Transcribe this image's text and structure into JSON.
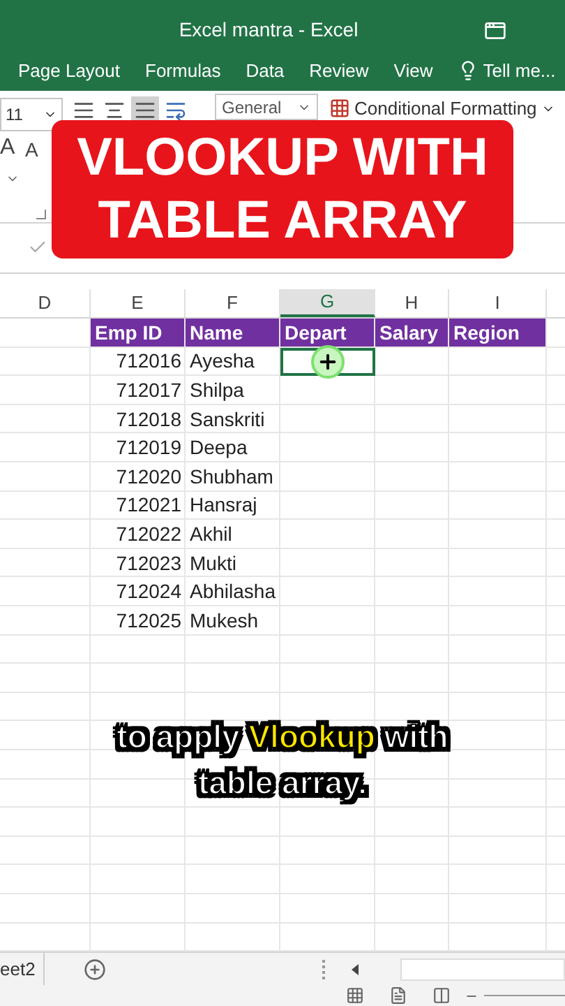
{
  "window": {
    "title": "Excel mantra - Excel"
  },
  "ribbon_tabs": [
    "Page Layout",
    "Formulas",
    "Data",
    "Review",
    "View"
  ],
  "tell_me": "Tell me...",
  "ribbon": {
    "font_size": "11",
    "font_grow": "A",
    "font_shrink": "A",
    "number_format": "General",
    "conditional_formatting": "Conditional Formatting"
  },
  "banner": {
    "lines": [
      "VLOOKUP WITH",
      "TABLE ARRAY"
    ]
  },
  "columns": [
    {
      "label": "D",
      "selected": false
    },
    {
      "label": "E",
      "selected": false
    },
    {
      "label": "F",
      "selected": false
    },
    {
      "label": "G",
      "selected": true
    },
    {
      "label": "H",
      "selected": false
    },
    {
      "label": "I",
      "selected": false
    }
  ],
  "table": {
    "columns": [
      "Emp ID",
      "Name",
      "Depart",
      "Salary",
      "Region"
    ],
    "rows": [
      {
        "emp_id": "712016",
        "name": "Ayesha"
      },
      {
        "emp_id": "712017",
        "name": "Shilpa"
      },
      {
        "emp_id": "712018",
        "name": "Sanskriti"
      },
      {
        "emp_id": "712019",
        "name": "Deepa"
      },
      {
        "emp_id": "712020",
        "name": "Shubham"
      },
      {
        "emp_id": "712021",
        "name": "Hansraj"
      },
      {
        "emp_id": "712022",
        "name": "Akhil"
      },
      {
        "emp_id": "712023",
        "name": "Mukti"
      },
      {
        "emp_id": "712024",
        "name": "Abhilasha"
      },
      {
        "emp_id": "712025",
        "name": "Mukesh"
      }
    ]
  },
  "caption": "to apply **Vlookup** with table array.",
  "sheet_tab": "eet2"
}
